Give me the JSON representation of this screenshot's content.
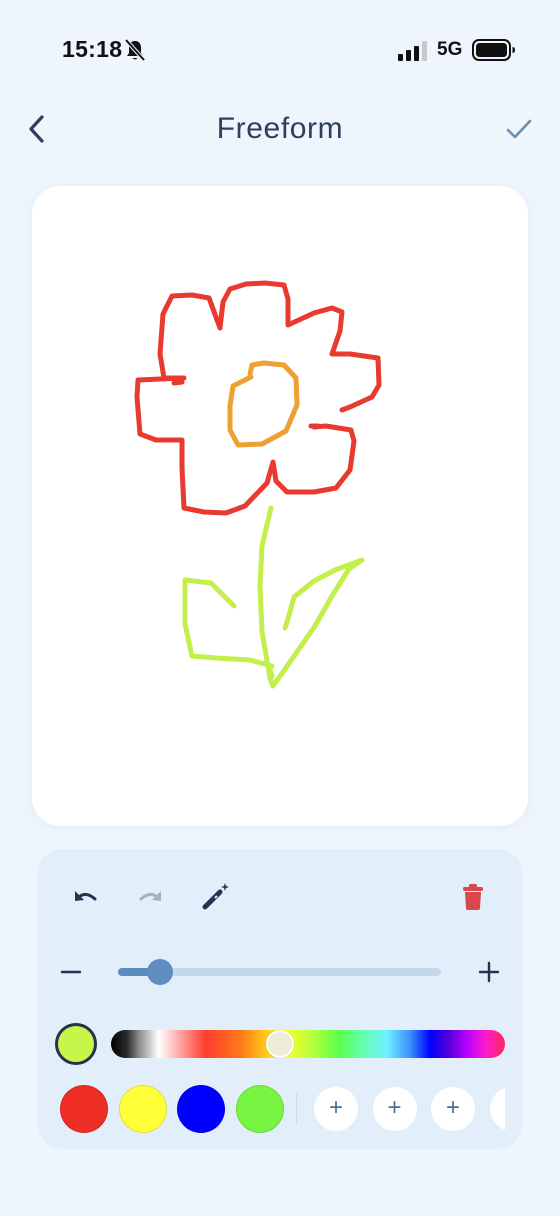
{
  "status_bar": {
    "time": "15:18",
    "network": "5G",
    "icons": [
      "bell-slash-icon",
      "cellular-signal-icon",
      "battery-icon"
    ]
  },
  "nav": {
    "title": "Freeform",
    "back_icon": "chevron-left-icon",
    "confirm_icon": "checkmark-icon"
  },
  "canvas": {
    "strokes": [
      {
        "name": "flower-petals-stroke",
        "color": "#e83a2e"
      },
      {
        "name": "flower-center-stroke",
        "color": "#eea033"
      },
      {
        "name": "stem-and-leaves-stroke",
        "color": "#c2ef4a"
      }
    ]
  },
  "toolbar": {
    "tools": [
      "undo-icon",
      "redo-icon",
      "magic-wand-icon",
      "trash-icon"
    ],
    "redo_enabled": false,
    "delete_color": "#d9494b"
  },
  "brush_size": {
    "minus_label": "−",
    "plus_label": "+",
    "level": 0.13
  },
  "color_picker": {
    "current_color": "#c8f54a",
    "hue_position": 0.43,
    "swatches": [
      "#ee2d24",
      "#ffff3a",
      "#0000ff",
      "#77f542"
    ],
    "add_slot_label": "+",
    "add_slot_count": 3
  }
}
